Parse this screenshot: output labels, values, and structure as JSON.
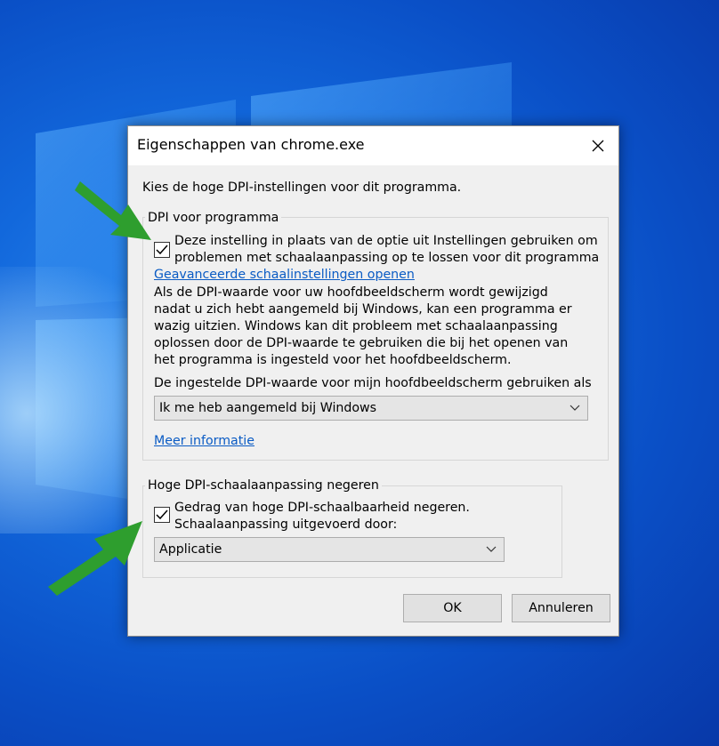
{
  "window": {
    "title": "Eigenschappen van chrome.exe"
  },
  "intro": "Kies de hoge DPI-instellingen voor dit programma.",
  "dpi_group": {
    "legend": "DPI voor programma",
    "checkbox_checked": true,
    "checkbox_line1": "Deze instelling in plaats van de optie uit Instellingen gebruiken om",
    "checkbox_line2": "problemen met schaalaanpassing op te lossen voor dit programma",
    "advanced_link": "Geavanceerde schaalinstellingen openen",
    "desc_lines": [
      "Als de DPI-waarde voor uw hoofdbeeldscherm wordt gewijzigd",
      "nadat u zich hebt aangemeld bij Windows, kan een programma er",
      "wazig uitzien. Windows kan dit probleem met schaalaanpassing",
      "oplossen door de DPI-waarde te gebruiken die bij het openen van",
      "het programma is ingesteld voor het hoofdbeeldscherm."
    ],
    "select_label": "De ingestelde DPI-waarde voor mijn hoofdbeeldscherm gebruiken als",
    "select_value": "Ik me heb aangemeld bij Windows",
    "more_info_link": "Meer informatie"
  },
  "override_group": {
    "legend": "Hoge DPI-schaalaanpassing negeren",
    "checkbox_checked": true,
    "checkbox_line1": "Gedrag van hoge DPI-schaalbaarheid negeren.",
    "checkbox_line2": "Schaalaanpassing uitgevoerd door:",
    "select_value": "Applicatie"
  },
  "buttons": {
    "ok": "OK",
    "cancel": "Annuleren"
  },
  "colors": {
    "desktop_blue": "#0a4fc6",
    "link_blue": "#0a5bc4",
    "arrow_green": "#2e9e2e"
  },
  "icons": {
    "close": "close-icon",
    "check": "check-icon",
    "dropdown": "chevron-down-icon",
    "annotation": "green-arrow"
  }
}
